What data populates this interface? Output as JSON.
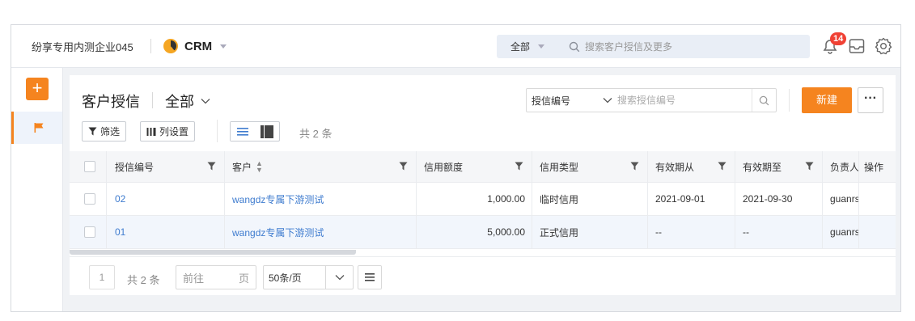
{
  "header": {
    "company": "纷享专用内测企业045",
    "app_name": "CRM",
    "search_scope": "全部",
    "search_placeholder": "搜索客户授信及更多",
    "notification_count": "14"
  },
  "sidebar": {
    "add_icon": "plus-icon",
    "items": [
      {
        "icon": "flag-icon",
        "active": true
      }
    ]
  },
  "page": {
    "title": "客户授信",
    "view": "全部",
    "filter_field": "授信编号",
    "filter_placeholder": "搜索授信编号",
    "new_label": "新建",
    "more_label": "···"
  },
  "toolbar": {
    "filter_label": "筛选",
    "columns_label": "列设置",
    "total_label": "共 2 条"
  },
  "table": {
    "columns": [
      "授信编号",
      "客户",
      "信用额度",
      "信用类型",
      "有效期从",
      "有效期至",
      "负责人",
      "操作"
    ],
    "rows": [
      {
        "code": "02",
        "customer": "wangdz专属下游测试",
        "amount": "1,000.00",
        "type": "临时信用",
        "from": "2021-09-01",
        "to": "2021-09-30",
        "owner": "guanrs"
      },
      {
        "code": "01",
        "customer": "wangdz专属下游测试",
        "amount": "5,000.00",
        "type": "正式信用",
        "from": "--",
        "to": "--",
        "owner": "guanrs"
      }
    ]
  },
  "pager": {
    "page": "1",
    "total": "共 2 条",
    "goto_prefix": "前往",
    "goto_suffix": "页",
    "page_size": "50条/页"
  },
  "colors": {
    "accent": "#f5841f",
    "link": "#3f7ccf",
    "badge": "#f04134"
  }
}
